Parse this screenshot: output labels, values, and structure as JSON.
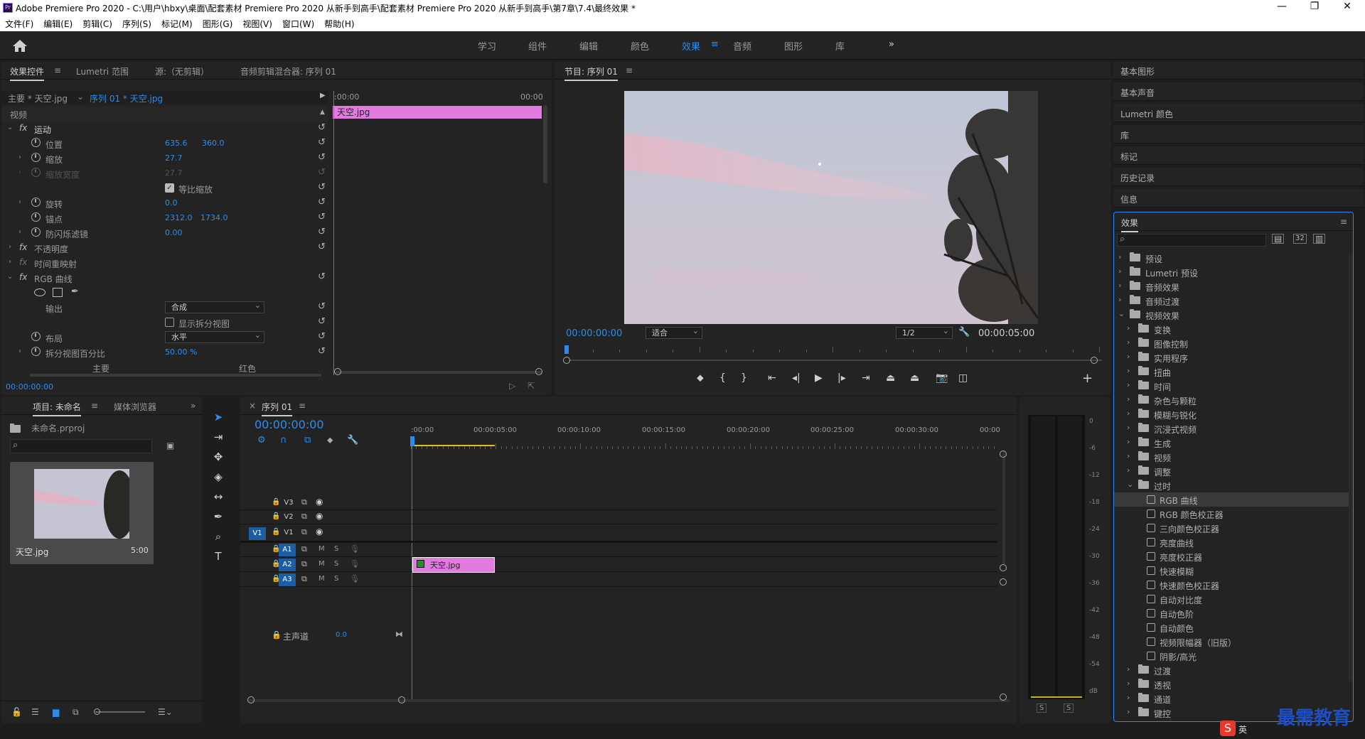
{
  "window": {
    "title": "Adobe Premiere Pro 2020 - C:\\用户\\hbxy\\桌面\\配套素材 Premiere Pro 2020 从新手到高手\\配套素材 Premiere Pro 2020 从新手到高手\\第7章\\7.4\\最终效果 *",
    "logo": "Pr",
    "min": "—",
    "max": "❐",
    "close": "✕"
  },
  "menu": [
    "文件(F)",
    "编辑(E)",
    "剪辑(C)",
    "序列(S)",
    "标记(M)",
    "图形(G)",
    "视图(V)",
    "窗口(W)",
    "帮助(H)"
  ],
  "workspaces": {
    "tabs": [
      "学习",
      "组件",
      "编辑",
      "颜色",
      "效果",
      "音频",
      "图形",
      "库"
    ],
    "active": "效果",
    "more": "»"
  },
  "effect_controls": {
    "tabs": [
      "效果控件",
      "Lumetri 范围",
      "源:（无剪辑）",
      "音频剪辑混合器: 序列 01"
    ],
    "master": "主要 * 天空.jpg",
    "sequence_clip": "序列 01 * 天空.jpg",
    "tl_start": ":00:00",
    "tl_end": "00:00",
    "clip_name": "天空.jpg",
    "video_header": "视频",
    "motion": "运动",
    "position_label": "位置",
    "position_x": "635.6",
    "position_y": "360.0",
    "scale_label": "缩放",
    "scale_val": "27.7",
    "scale_w_label": "缩放宽度",
    "scale_w_val": "27.7",
    "uniform_label": "等比缩放",
    "rotation_label": "旋转",
    "rotation_val": "0.0",
    "anchor_label": "锚点",
    "anchor_x": "2312.0",
    "anchor_y": "1734.0",
    "flicker_label": "防闪烁滤镜",
    "flicker_val": "0.00",
    "opacity_label": "不透明度",
    "time_remap_label": "时间重映射",
    "rgb_curves_label": "RGB 曲线",
    "output_label": "输出",
    "output_val": "合成",
    "split_view_label": "显示拆分视图",
    "layout_label": "布局",
    "layout_val": "水平",
    "split_pct_label": "拆分视图百分比",
    "split_pct_val": "50.00 %",
    "master_curve": "主要",
    "red_curve": "红色",
    "timecode": "00:00:00:00"
  },
  "program": {
    "title": "节目: 序列 01",
    "timecode": "00:00:00:00",
    "fit": "适合",
    "res": "1/2",
    "duration": "00:00:05:00"
  },
  "project": {
    "tabs": [
      "项目: 未命名",
      "媒体浏览器"
    ],
    "file": "未命名.prproj",
    "clip_name": "天空.jpg",
    "clip_duration": "5:00"
  },
  "timeline": {
    "tab": "序列 01",
    "timecode": "00:00:00:00",
    "ruler": [
      ":00:00",
      "00:00:05:00",
      "00:00:10:00",
      "00:00:15:00",
      "00:00:20:00",
      "00:00:25:00",
      "00:00:30:00",
      "00:00"
    ],
    "tracks": [
      {
        "name": "V3",
        "toggle": "",
        "type": "video"
      },
      {
        "name": "V2",
        "toggle": "",
        "type": "video"
      },
      {
        "name": "V1",
        "toggle": "V1",
        "type": "video"
      },
      {
        "name": "A1",
        "toggle": "",
        "type": "audio"
      },
      {
        "name": "A2",
        "toggle": "",
        "type": "audio"
      },
      {
        "name": "A3",
        "toggle": "",
        "type": "audio"
      }
    ],
    "mute": "M",
    "solo": "S",
    "master": "主声道",
    "master_val": "0.0",
    "clip": "天空.jpg"
  },
  "meter": {
    "scale": [
      "0",
      "-6",
      "-12",
      "-18",
      "-24",
      "-30",
      "-36",
      "-42",
      "-48",
      "-54",
      "dB"
    ],
    "solo_l": "S",
    "solo_r": "S"
  },
  "side_panels": [
    "基本图形",
    "基本声音",
    "Lumetri 颜色",
    "库",
    "标记",
    "历史记录",
    "信息"
  ],
  "effects": {
    "title": "效果",
    "top_folders": [
      "预设",
      "Lumetri 预设",
      "音频效果",
      "音频过渡",
      "视频效果"
    ],
    "video_sub": [
      "变换",
      "图像控制",
      "实用程序",
      "扭曲",
      "时间",
      "杂色与颗粒",
      "模糊与锐化",
      "沉浸式视频",
      "生成",
      "视频",
      "调整",
      "过时"
    ],
    "obsolete": [
      "RGB 曲线",
      "RGB 颜色校正器",
      "三向颜色校正器",
      "亮度曲线",
      "亮度校正器",
      "快速模糊",
      "快速颜色校正器",
      "自动对比度",
      "自动色阶",
      "自动颜色",
      "视频限幅器（旧版）",
      "阴影/高光"
    ],
    "tail_folders": [
      "过渡",
      "透视",
      "通道",
      "键控"
    ]
  },
  "watermark": "最需教育",
  "ime": "英",
  "colors": {
    "accent": "#2d8ceb",
    "clip": "#e27be0",
    "panel": "#232323",
    "bg": "#1d1d1d"
  }
}
